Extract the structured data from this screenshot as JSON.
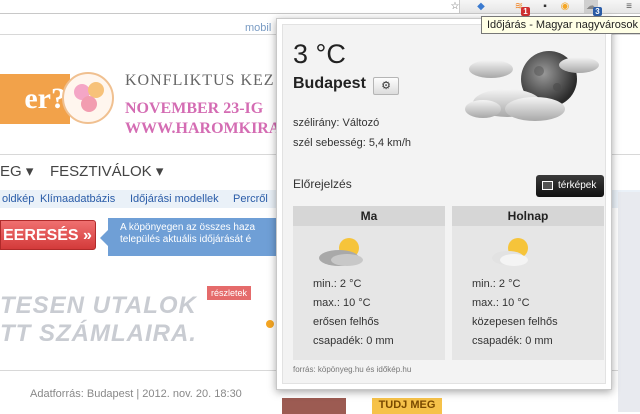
{
  "tooltip": "Időjárás - Magyar nagyvárosok",
  "toolbar": {
    "badge_red": "1",
    "badge_blue": "3"
  },
  "page": {
    "mobile_link": "mobil",
    "banner_left": "er?",
    "banner_line1": "KONFLIKTUS KEZ",
    "banner_line2": "NOVEMBER 23-IG",
    "banner_line3": "WWW.HAROMKIRA",
    "nav_item1": "EG ▾",
    "nav_item2": "FESZTIVÁLOK ▾",
    "subnav": [
      "oldkép",
      "Klímaadatbázis",
      "Időjárási modellek",
      "Percről"
    ],
    "search_button": "EERESÉS »",
    "info_text": "A köpönyegen az összes haza település aktuális időjárását é",
    "reszletek": "részletek",
    "promo_line1": "TESEN UTALOK",
    "promo_line2": "TT SZÁMLAIRA.",
    "adatforras": "Adatforrás: Budapest | 2012. nov. 20. 18:30",
    "tudj_meg": "TUDJ MEG"
  },
  "weather": {
    "temperature": "3 °C",
    "city": "Budapest",
    "wind_direction": "szélirány: Változó",
    "wind_speed": "szél sebesség: 5,4 km/h",
    "forecast_label": "Előrejelzés",
    "maps_button": "térképek",
    "days": [
      {
        "name": "Ma",
        "min": "min.: 2 °C",
        "max": "max.: 10 °C",
        "condition": "erősen felhős",
        "precip": "csapadék: 0 mm",
        "icon": "partly-cloudy-icon"
      },
      {
        "name": "Holnap",
        "min": "min.: 2 °C",
        "max": "max.: 10 °C",
        "condition": "közepesen felhős",
        "precip": "csapadék: 0 mm",
        "icon": "partly-cloudy-icon"
      }
    ],
    "source": "forrás: köpönyeg.hu és időkép.hu",
    "current_icon": "cloudy-night-moon-icon"
  },
  "colors": {
    "accent_red": "#d33a3a",
    "banner_pink": "#d46cb3",
    "info_blue": "#6f9fd6"
  }
}
